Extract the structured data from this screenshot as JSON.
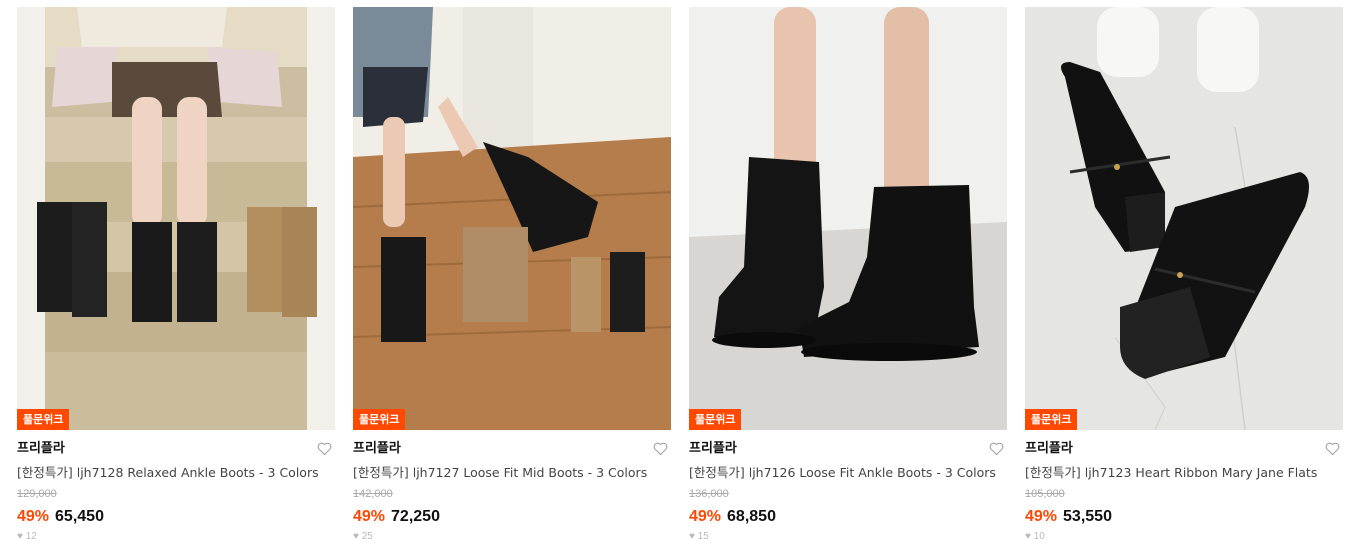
{
  "products": [
    {
      "badge": "풀문위크",
      "brand": "프리플라",
      "title": "[한정특가] ljh7128 Relaxed Ankle Boots - 3 Colors",
      "original_price": "129,000",
      "discount": "49%",
      "price": "65,450",
      "extra": "♥ 12"
    },
    {
      "badge": "풀문위크",
      "brand": "프리플라",
      "title": "[한정특가] ljh7127 Loose Fit Mid Boots - 3 Colors",
      "original_price": "142,000",
      "discount": "49%",
      "price": "72,250",
      "extra": "♥ 25"
    },
    {
      "badge": "풀문위크",
      "brand": "프리플라",
      "title": "[한정특가] ljh7126 Loose Fit Ankle Boots - 3 Colors",
      "original_price": "136,000",
      "discount": "49%",
      "price": "68,850",
      "extra": "♥ 15"
    },
    {
      "badge": "풀문위크",
      "brand": "프리플라",
      "title": "[한정특가] ljh7123 Heart Ribbon Mary Jane Flats",
      "original_price": "105,000",
      "discount": "49%",
      "price": "53,550",
      "extra": "♥ 10"
    }
  ],
  "colors": {
    "accent": "#ff4800",
    "strike": "#aaaaaa",
    "text": "#111111"
  },
  "icons": {
    "wishlist": "heart-outline-icon"
  }
}
